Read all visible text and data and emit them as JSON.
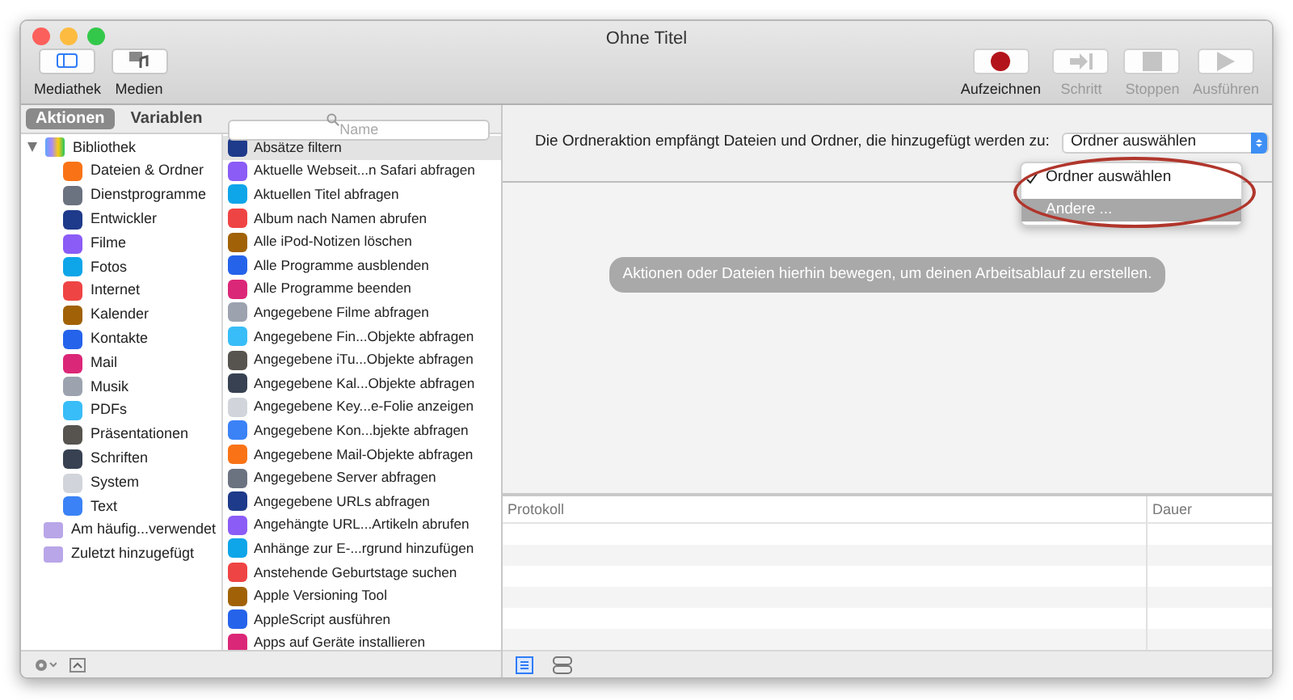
{
  "window": {
    "title": "Ohne Titel"
  },
  "toolbar_left": [
    {
      "label": "Mediathek",
      "selected": true
    },
    {
      "label": "Medien",
      "selected": false
    }
  ],
  "toolbar_right": [
    {
      "kind": "record",
      "label": "Aufzeichnen",
      "disabled": false
    },
    {
      "kind": "step",
      "label": "Schritt",
      "disabled": true
    },
    {
      "kind": "stop",
      "label": "Stoppen",
      "disabled": true
    },
    {
      "kind": "run",
      "label": "Ausführen",
      "disabled": true
    }
  ],
  "library_tabs": [
    {
      "label": "Aktionen",
      "selected": true
    },
    {
      "label": "Variablen",
      "selected": false
    }
  ],
  "search": {
    "placeholder": "Name"
  },
  "categories": [
    {
      "label": "Bibliothek",
      "expanded": true,
      "children": [
        {
          "label": "Dateien & Ordner"
        },
        {
          "label": "Dienstprogramme"
        },
        {
          "label": "Entwickler"
        },
        {
          "label": "Filme"
        },
        {
          "label": "Fotos"
        },
        {
          "label": "Internet"
        },
        {
          "label": "Kalender"
        },
        {
          "label": "Kontakte"
        },
        {
          "label": "Mail"
        },
        {
          "label": "Musik"
        },
        {
          "label": "PDFs"
        },
        {
          "label": "Präsentationen"
        },
        {
          "label": "Schriften"
        },
        {
          "label": "System"
        },
        {
          "label": "Text"
        }
      ]
    },
    {
      "label": "Am häufig...verwendet"
    },
    {
      "label": "Zuletzt hinzugefügt"
    }
  ],
  "actions": [
    {
      "label": "Absätze filtern",
      "selected": true
    },
    {
      "label": "Aktuelle Webseit...n Safari abfragen",
      "selected": false
    },
    {
      "label": "Aktuellen Titel abfragen",
      "selected": false
    },
    {
      "label": "Album nach Namen abrufen",
      "selected": false
    },
    {
      "label": "Alle iPod-Notizen löschen",
      "selected": false
    },
    {
      "label": "Alle Programme ausblenden",
      "selected": false
    },
    {
      "label": "Alle Programme beenden",
      "selected": false
    },
    {
      "label": "Angegebene Filme abfragen",
      "selected": false
    },
    {
      "label": "Angegebene Fin...Objekte abfragen",
      "selected": false
    },
    {
      "label": "Angegebene iTu...Objekte abfragen",
      "selected": false
    },
    {
      "label": "Angegebene Kal...Objekte abfragen",
      "selected": false
    },
    {
      "label": "Angegebene Key...e-Folie anzeigen",
      "selected": false
    },
    {
      "label": "Angegebene Kon...bjekte abfragen",
      "selected": false
    },
    {
      "label": "Angegebene Mail-Objekte abfragen",
      "selected": false
    },
    {
      "label": "Angegebene Server abfragen",
      "selected": false
    },
    {
      "label": "Angegebene URLs abfragen",
      "selected": false
    },
    {
      "label": "Angehängte URL...Artikeln abrufen",
      "selected": false
    },
    {
      "label": "Anhänge zur E-...rgrund hinzufügen",
      "selected": false
    },
    {
      "label": "Anstehende Geburtstage suchen",
      "selected": false
    },
    {
      "label": "Apple Versioning Tool",
      "selected": false
    },
    {
      "label": "AppleScript ausführen",
      "selected": false
    },
    {
      "label": "Apps auf Geräte installieren",
      "selected": false
    }
  ],
  "workflow": {
    "prompt": "Die Ordneraktion empfängt Dateien und Ordner, die hinzugefügt werden zu:",
    "select_value": "Ordner auswählen",
    "menu": [
      {
        "label": "Ordner auswählen",
        "checked": true,
        "selected": false
      },
      {
        "label": "Andere ...",
        "checked": false,
        "selected": true
      }
    ],
    "hint": "Aktionen oder Dateien hierhin bewegen, um deinen Arbeitsablauf zu erstellen."
  },
  "log": {
    "columns": [
      "Protokoll",
      "Dauer"
    ]
  }
}
